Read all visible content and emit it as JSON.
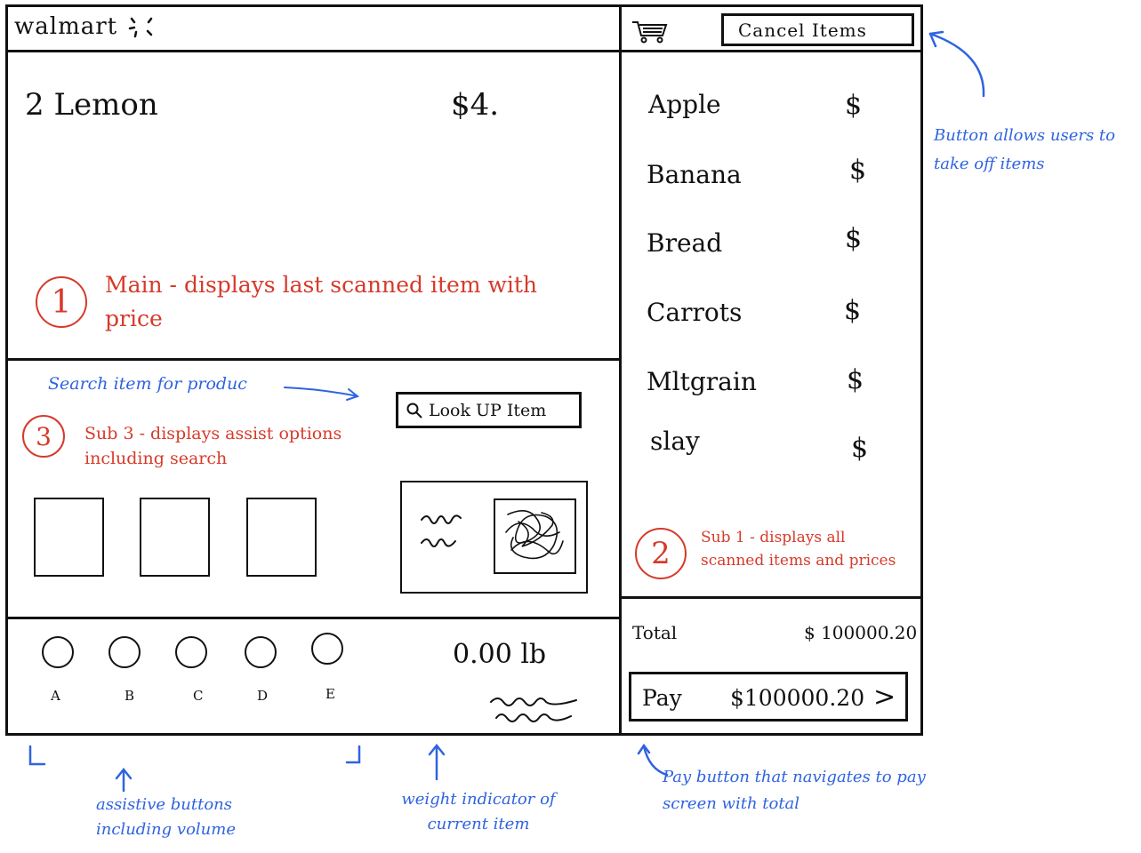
{
  "header": {
    "logo": "walmart",
    "cancel_label": "Cancel Items"
  },
  "main": {
    "last_item": "2 Lemon",
    "last_price": "$4.",
    "annotation_number": "1",
    "annotation": "Main - displays last scanned item with price"
  },
  "scanned_list": {
    "items": [
      {
        "name": "Apple",
        "price": "$"
      },
      {
        "name": "Banana",
        "price": "$"
      },
      {
        "name": "Bread",
        "price": "$"
      },
      {
        "name": "Carrots",
        "price": "$"
      },
      {
        "name": "Mltgrain",
        "price": "$"
      },
      {
        "name": "slay",
        "price": "$"
      }
    ],
    "annotation_number": "2",
    "annotation": "Sub 1 - displays all scanned items and prices"
  },
  "totals": {
    "total_label": "Total",
    "total_value": "$ 100000.20",
    "pay_label": "Pay",
    "pay_value": "$100000.20",
    "pay_arrow": ">"
  },
  "assist": {
    "search_note": "Search item for produc",
    "lookup_label": "Look UP Item",
    "annotation_number": "3",
    "annotation": "Sub 3 - displays assist options including search"
  },
  "bottom": {
    "buttons": [
      "A",
      "B",
      "C",
      "D",
      "E"
    ],
    "weight": "0.00 lb"
  },
  "notes": {
    "cancel_note": "Button allows users to take off items",
    "assistive_note": "assistive buttons including volume",
    "weight_note": "weight indicator of current item",
    "pay_note": "Pay button that navigates to pay screen with total"
  },
  "colors": {
    "ink": "#111111",
    "annotation_red": "#d63a2a",
    "annotation_blue": "#2f63e0"
  }
}
